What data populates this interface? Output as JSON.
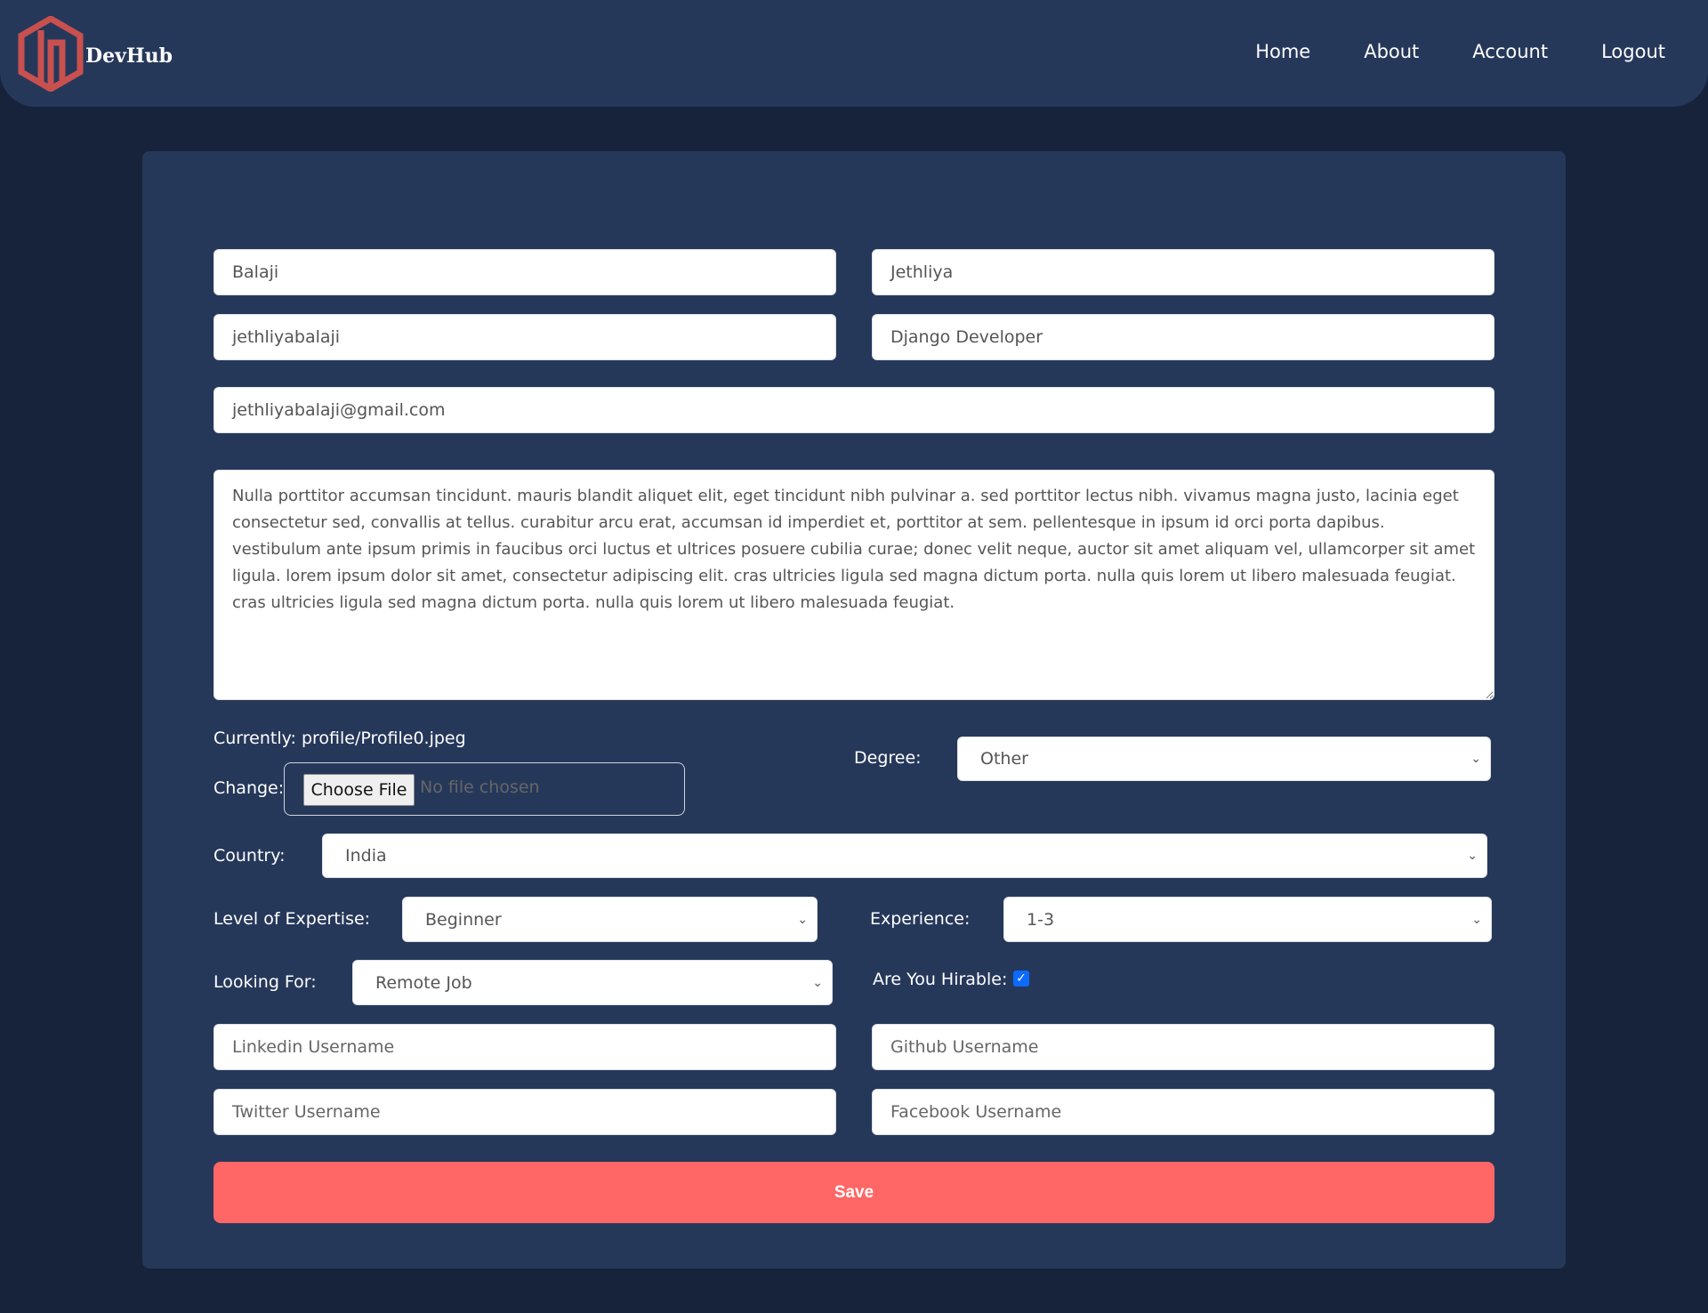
{
  "header": {
    "brand": "DevHub",
    "nav": [
      "Home",
      "About",
      "Account",
      "Logout"
    ],
    "logo_color": "#c8504f"
  },
  "form": {
    "first_name": "Balaji",
    "last_name": "Jethliya",
    "username": "jethliyabalaji",
    "headline": "Django Developer",
    "email": "jethliyabalaji@gmail.com",
    "bio": "Nulla porttitor accumsan tincidunt. mauris blandit aliquet elit, eget tincidunt nibh pulvinar a. sed porttitor lectus nibh. vivamus magna justo, lacinia eget consectetur sed, convallis at tellus. curabitur arcu erat, accumsan id imperdiet et, porttitor at sem. pellentesque in ipsum id orci porta dapibus. vestibulum ante ipsum primis in faucibus orci luctus et ultrices posuere cubilia curae; donec velit neque, auctor sit amet aliquam vel, ullamcorper sit amet ligula. lorem ipsum dolor sit amet, consectetur adipiscing elit. cras ultricies ligula sed magna dictum porta. nulla quis lorem ut libero malesuada feugiat. cras ultricies ligula sed magna dictum porta. nulla quis lorem ut libero malesuada feugiat.",
    "currently_label": "Currently: profile/Profile0.jpeg",
    "change_label": "Change:",
    "choose_file": "Choose File",
    "no_file": "No file chosen",
    "degree_label": "Degree:",
    "degree_value": "Other",
    "country_label": "Country:",
    "country_value": "India",
    "expertise_label": "Level of Expertise:",
    "expertise_value": "Beginner",
    "experience_label": "Experience:",
    "experience_value": "1-3",
    "looking_label": "Looking For:",
    "looking_value": "Remote Job",
    "hirable_label": "Are You Hirable:",
    "hirable_checked": true,
    "linkedin_placeholder": "Linkedin Username",
    "github_placeholder": "Github Username",
    "twitter_placeholder": "Twitter Username",
    "facebook_placeholder": "Facebook Username",
    "save_label": "Save",
    "save_color": "#ff6666"
  }
}
